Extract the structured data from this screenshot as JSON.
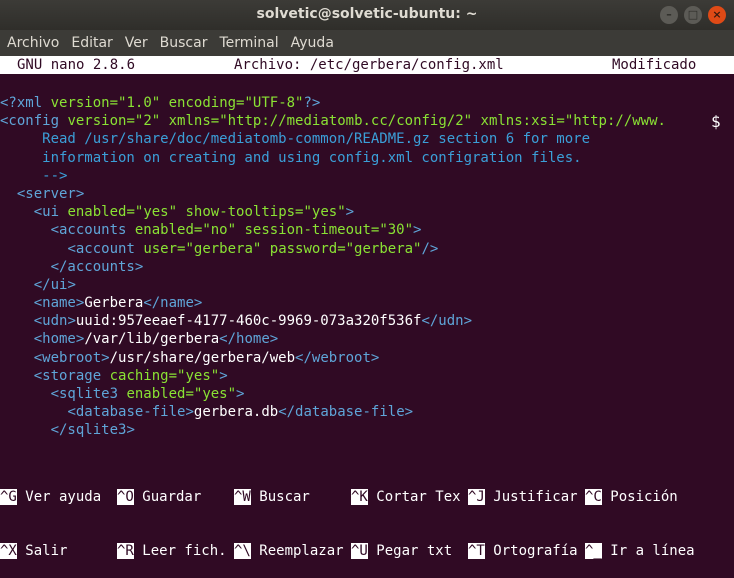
{
  "window": {
    "title": "solvetic@solvetic-ubuntu: ~",
    "buttons": [
      "–",
      "□",
      "×"
    ]
  },
  "menu": [
    "Archivo",
    "Editar",
    "Ver",
    "Buscar",
    "Terminal",
    "Ayuda"
  ],
  "nano": {
    "version": "GNU nano 2.8.6",
    "file": "Archivo: /etc/gerbera/config.xml",
    "status": "Modificado"
  },
  "lines": [
    "<?xml version=\"1.0\" encoding=\"UTF-8\"?>",
    "<config version=\"2\" xmlns=\"http://mediatomb.cc/config/2\" xmlns:xsi=\"http://www.",
    "     Read /usr/share/doc/mediatomb-common/README.gz section 6 for more",
    "     information on creating and using config.xml configration files.",
    "     -->",
    "  <server>",
    "    <ui enabled=\"yes\" show-tooltips=\"yes\">",
    "      <accounts enabled=\"no\" session-timeout=\"30\">",
    "        <account user=\"gerbera\" password=\"gerbera\"/>",
    "      </accounts>",
    "    </ui>",
    "    <name>Gerbera</name>",
    "    <udn>uuid:957eeaef-4177-460c-9969-073a320f536f</udn>",
    "    <home>/var/lib/gerbera</home>",
    "    <webroot>/usr/share/gerbera/web</webroot>",
    "    <storage caching=\"yes\">",
    "      <sqlite3 enabled=\"yes\">",
    "        <database-file>gerbera.db</database-file>",
    "      </sqlite3>"
  ],
  "overflow_marker": "$",
  "shortcuts": {
    "row1": [
      {
        "key": "^G",
        "label": "Ver ayuda"
      },
      {
        "key": "^O",
        "label": "Guardar"
      },
      {
        "key": "^W",
        "label": "Buscar"
      },
      {
        "key": "^K",
        "label": "Cortar Tex"
      },
      {
        "key": "^J",
        "label": "Justificar"
      },
      {
        "key": "^C",
        "label": "Posición"
      }
    ],
    "row2": [
      {
        "key": "^X",
        "label": "Salir"
      },
      {
        "key": "^R",
        "label": "Leer fich."
      },
      {
        "key": "^\\",
        "label": "Reemplazar"
      },
      {
        "key": "^U",
        "label": "Pegar txt"
      },
      {
        "key": "^T",
        "label": "Ortografía"
      },
      {
        "key": "^_",
        "label": "Ir a línea"
      }
    ]
  },
  "colors": {
    "background": "#300a24",
    "tag": "#5fa5d8",
    "attr": "#8ae234",
    "comment": "#3b9fd8"
  }
}
